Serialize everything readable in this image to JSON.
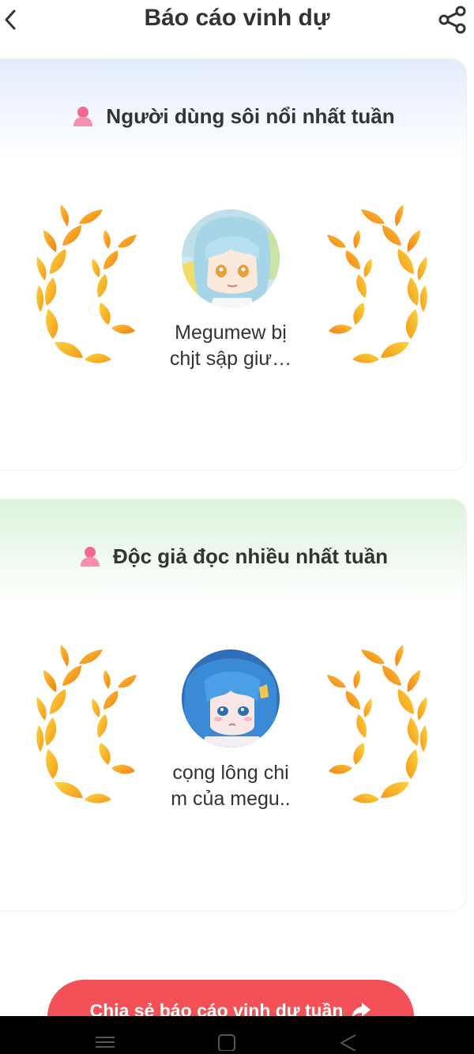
{
  "header": {
    "title": "Báo cáo vinh dự"
  },
  "cards": [
    {
      "title": "Người dùng sôi nổi nhất tuần",
      "name": "Megumew bị\nchjt sập giư…",
      "accent": "#e3edfb"
    },
    {
      "title": "Độc giả đọc nhiều nhất tuần",
      "name": "cọng lông chi\nm của megu..",
      "accent": "#dcf3dc"
    }
  ],
  "share_button": {
    "label": "Chia sẻ báo cáo vinh dự tuần",
    "color": "#f45058"
  },
  "icons": {
    "back": "chevron-left-icon",
    "share": "share-icon",
    "user": "user-icon",
    "laurel": "laurel-wreath-icon",
    "nav": [
      "menu-icon",
      "home-square-icon",
      "back-triangle-icon"
    ]
  },
  "colors": {
    "laurel_gold": "#f9b61a",
    "laurel_orange": "#f58220",
    "user_icon_pink": "#f0608a"
  }
}
